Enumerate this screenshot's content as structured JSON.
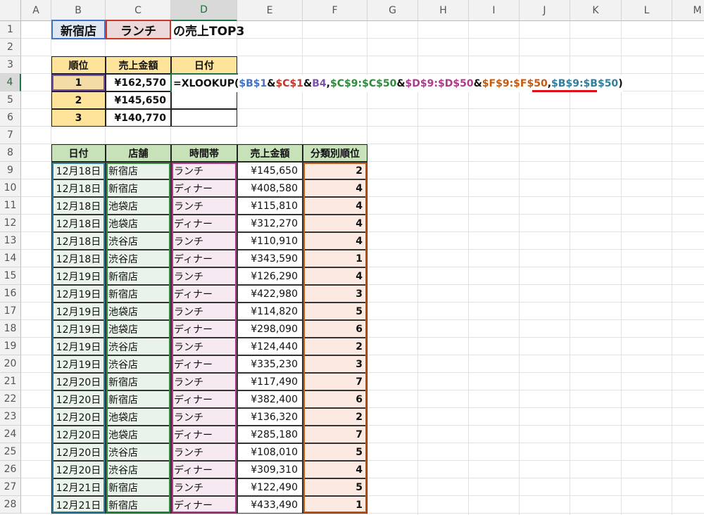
{
  "columns": [
    "A",
    "B",
    "C",
    "D",
    "E",
    "F",
    "G",
    "H",
    "I",
    "J",
    "K",
    "L",
    "M"
  ],
  "rows": [
    "1",
    "2",
    "3",
    "4",
    "5",
    "6",
    "7",
    "8",
    "9",
    "10",
    "11",
    "12",
    "13",
    "14",
    "15",
    "16",
    "17",
    "18",
    "19",
    "20",
    "21",
    "22",
    "23",
    "24",
    "25",
    "26",
    "27",
    "28"
  ],
  "title": {
    "store": "新宿店",
    "period": "ランチ",
    "suffix": "の売上TOP3"
  },
  "top3": {
    "headers": [
      "順位",
      "売上金額",
      "日付"
    ],
    "rows": [
      {
        "rank": "1",
        "amount": "¥162,570"
      },
      {
        "rank": "2",
        "amount": "¥145,650"
      },
      {
        "rank": "3",
        "amount": "¥140,770"
      }
    ]
  },
  "formula": {
    "prefix": "=XLOOKUP(",
    "b1": "$B$1",
    "amp1": "&",
    "c1": "$C$1",
    "amp2": "&",
    "b4": "B4",
    "comma1": ",",
    "c_range": "$C$9:$C$50",
    "amp3": "&",
    "d_range": "$D$9:$D$50",
    "amp4": "&",
    "f_range": "$F$9:$F$50",
    "comma2": ",",
    "b_range": "$B$9:$B$50",
    "close": ")"
  },
  "colors": {
    "ref_blue": "#4472c4",
    "ref_red": "#c0392b",
    "ref_purple": "#7b52ab",
    "ref_green": "#2e8b3a",
    "ref_magenta": "#b03a8a",
    "ref_orange": "#c55a11",
    "ref_teal": "#2f7f9f",
    "accent_green": "#217346",
    "underline_red": "#e0101a"
  },
  "table": {
    "headers": [
      "日付",
      "店舗",
      "時間帯",
      "売上金額",
      "分類別順位"
    ],
    "rows": [
      [
        "12月18日",
        "新宿店",
        "ランチ",
        "¥145,650",
        "2"
      ],
      [
        "12月18日",
        "新宿店",
        "ディナー",
        "¥408,580",
        "4"
      ],
      [
        "12月18日",
        "池袋店",
        "ランチ",
        "¥115,810",
        "4"
      ],
      [
        "12月18日",
        "池袋店",
        "ディナー",
        "¥312,270",
        "4"
      ],
      [
        "12月18日",
        "渋谷店",
        "ランチ",
        "¥110,910",
        "4"
      ],
      [
        "12月18日",
        "渋谷店",
        "ディナー",
        "¥343,590",
        "1"
      ],
      [
        "12月19日",
        "新宿店",
        "ランチ",
        "¥126,290",
        "4"
      ],
      [
        "12月19日",
        "新宿店",
        "ディナー",
        "¥422,980",
        "3"
      ],
      [
        "12月19日",
        "池袋店",
        "ランチ",
        "¥114,820",
        "5"
      ],
      [
        "12月19日",
        "池袋店",
        "ディナー",
        "¥298,090",
        "6"
      ],
      [
        "12月19日",
        "渋谷店",
        "ランチ",
        "¥124,440",
        "2"
      ],
      [
        "12月19日",
        "渋谷店",
        "ディナー",
        "¥335,230",
        "3"
      ],
      [
        "12月20日",
        "新宿店",
        "ランチ",
        "¥117,490",
        "7"
      ],
      [
        "12月20日",
        "新宿店",
        "ディナー",
        "¥382,400",
        "6"
      ],
      [
        "12月20日",
        "池袋店",
        "ランチ",
        "¥136,320",
        "2"
      ],
      [
        "12月20日",
        "池袋店",
        "ディナー",
        "¥285,180",
        "7"
      ],
      [
        "12月20日",
        "渋谷店",
        "ランチ",
        "¥108,010",
        "5"
      ],
      [
        "12月20日",
        "渋谷店",
        "ディナー",
        "¥309,310",
        "4"
      ],
      [
        "12月21日",
        "新宿店",
        "ランチ",
        "¥122,490",
        "5"
      ],
      [
        "12月21日",
        "新宿店",
        "ディナー",
        "¥433,490",
        "1"
      ]
    ]
  }
}
